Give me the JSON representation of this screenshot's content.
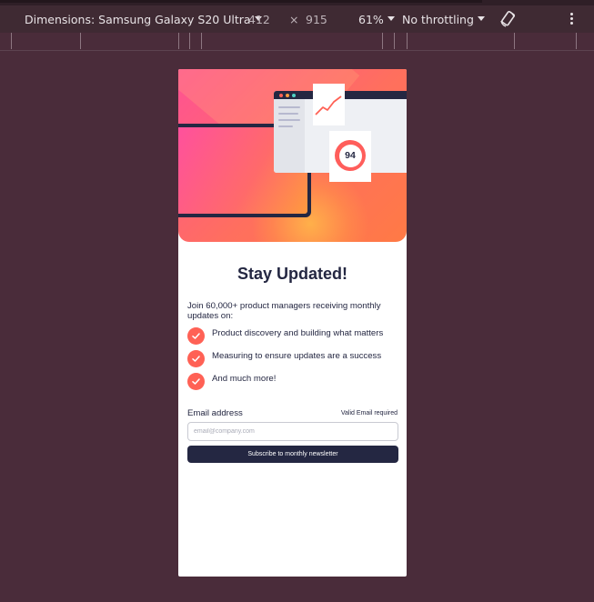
{
  "devtools": {
    "device_label": "Dimensions: Samsung Galaxy S20 Ultra",
    "width": "412",
    "times": "×",
    "height": "915",
    "zoom": "61%",
    "throttling": "No throttling",
    "icons": [
      "chevron-down-icon",
      "rotate-icon",
      "kebab-menu-icon"
    ]
  },
  "page": {
    "hero_score": "94",
    "title": "Stay Updated!",
    "intro": "Join 60,000+ product managers receiving monthly updates on:",
    "features": [
      "Product discovery and building what matters",
      "Measuring to ensure updates are a success",
      "And much more!"
    ],
    "form": {
      "email_label": "Email address",
      "email_error": "Valid Email required",
      "email_placeholder": "email@company.com",
      "email_value": "",
      "submit_label": "Subscribe to monthly newsletter"
    }
  },
  "colors": {
    "accent": "#ff6155",
    "dark_navy": "#242742",
    "backdrop": "#4a2c3a"
  }
}
